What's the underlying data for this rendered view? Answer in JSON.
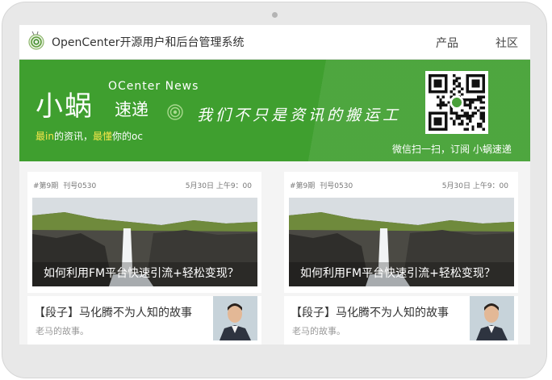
{
  "header": {
    "site_title": "OpenCenter开源用户和后台管理系统",
    "nav": [
      "产品",
      "社区"
    ]
  },
  "banner": {
    "brand_big": "小蜗",
    "brand_en": "OCenter News",
    "brand_sub": "速递",
    "slogan": "我们不只是资讯的搬运工",
    "tagline": {
      "p1": "最",
      "h1": "in",
      "p2": "的资讯，",
      "h2": "最懂",
      "p3": "你的oc"
    },
    "qr_caption": "微信扫一扫，订阅 小蜗速递",
    "color": "#3f9f2f",
    "highlight_color": "#f5e64a"
  },
  "cards": [
    {
      "issue": "#第9期",
      "number": "刊号0530",
      "time": "5月30日 上午9：00",
      "headline": "如何利用FM平台快速引流+轻松变现？",
      "story_title": "【段子】马化腾不为人知的故事",
      "story_desc": "老马的故事。"
    },
    {
      "issue": "#第9期",
      "number": "刊号0530",
      "time": "5月30日 上午9：00",
      "headline": "如何利用FM平台快速引流+轻松变现？",
      "story_title": "【段子】马化腾不为人知的故事",
      "story_desc": "老马的故事。"
    }
  ],
  "icons": {
    "logo": "snail-logo-icon",
    "qr": "wechat-qr-code"
  }
}
